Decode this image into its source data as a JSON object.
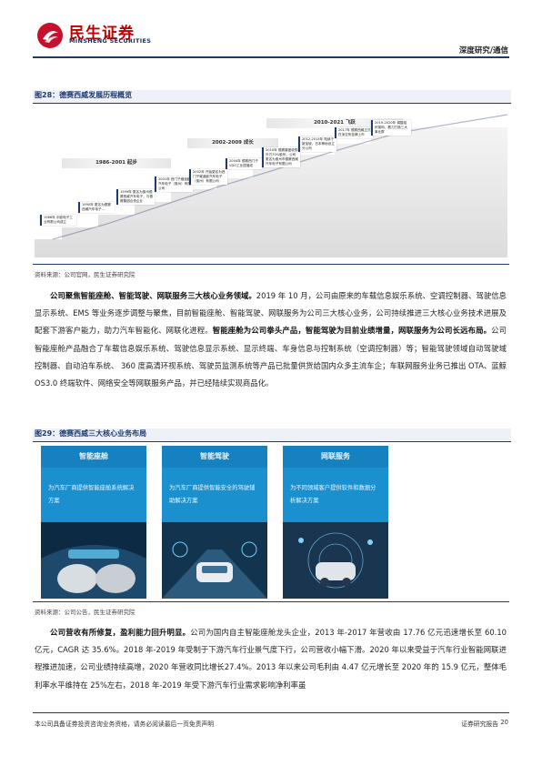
{
  "header": {
    "brand_cn": "民生证券",
    "brand_en": "MINSHENG SECURITIES",
    "section": "深度研究/通信"
  },
  "figure28": {
    "title": "图28：德赛西威发展历程概览",
    "source": "资料来源：公司官网，民生证券研究院",
    "bands": [
      {
        "label": "1986-2001  起步"
      },
      {
        "label": "2002-2009  成长"
      },
      {
        "label": "2010-2021  飞跃"
      }
    ],
    "milestones": [
      {
        "text": "1986年 中欧电子工业有限公司成立"
      },
      {
        "text": "1990年 更名为德赛西威汽车电子…"
      },
      {
        "text": "1999年 更名为惠州德赛西威汽车电子，与德赛集团合资企业"
      },
      {
        "text": "2001年 西门子威迪欧汽车电子（惠州）有限公司"
      },
      {
        "text": "2002年 开始更名为西门子威迪欧汽车电子（惠州）有限公司"
      },
      {
        "text": "2004年 德赛西门子VDO工业园落成"
      },
      {
        "text": "2010年 德赛集团收购外方70%股份，公司更名为惠州市德赛西威汽车电子有限公司"
      },
      {
        "text": "2012-2013年 陆续于新加坡、日本等地设立分公司"
      },
      {
        "text": "2017年 德赛西威正式在深交所挂牌上市"
      },
      {
        "text": "2019-2020年 调整组织架构，着力打造三大事业群"
      }
    ]
  },
  "body1": {
    "p1_bold": "公司聚焦智能座舱、智能驾驶、网联服务三大核心业务领域。",
    "p1_a": "2019 年 10 月，公司由原来的车载信息娱乐系统、空调控制器、驾驶信息显示系统、EMS 等业务逐步调整与聚焦，目前智能座舱、智能驾驶、网联服务为公司三大核心业务，公司持续推进三大核心业务技术进展及配套下游客户能力，助力汽车智能化、网联化进程。",
    "p1_bold2": "智能座舱为公司拳头产品，智能驾驶为目前业绩增量，网联服务为公司长远布局。",
    "p1_b": "公司智能座舱产品融合了车载信息娱乐系统、驾驶信息显示系统、显示终端、车身信息与控制系统（空调控制器）等；智能驾驶领域自动驾驶域控制器、自动泊车系统、 360 度高清环视系统、驾驶员监测系统等产品已批量供货给国内众多主流车企；车联网服务业务已推出 OTA、蓝鲸 OS3.0 终端软件、网络安全等网联服务产品，并已经陆续实现商品化。"
  },
  "figure29": {
    "title": "图29：德赛西威三大核心业务布局",
    "source": "资料来源：公司公告，民生证券研究院",
    "panels": [
      {
        "head": "智能座舱",
        "desc": "为汽车厂商提供智能座舱系统解决方案"
      },
      {
        "head": "智能驾驶",
        "desc": "为汽车厂商提供智能安全的驾驶辅助解决方案"
      },
      {
        "head": "网联服务",
        "desc": "为不同领域客户提供软件和数据分析解决方案"
      }
    ]
  },
  "body2": {
    "p_bold": "公司营收有所修复，盈利能力回升明显。",
    "p_text": "公司为国内自主智能座舱龙头企业，2013 年-2017 年营收由 17.76 亿元迅速增长至 60.10 亿元，CAGR 达 35.6%。2018 年-2019 年受制于下游汽车行业景气度下行，公司营收小幅下滑。2020 年以来受益于汽车行业智能网联进程推进加速，公司业绩持续高增，2020 年营收同比增长27.4%。2013 年以来公司毛利由 4.47 亿元增长至 2020 年的 15.9 亿元，整体毛利率水平维持在 25%左右，2018 年-2019 年受下游汽车行业需求影响净利率虽"
  },
  "footer": {
    "disclaimer": "本公司具备证券投资咨询业务资格，请务必阅读最后一页免责声明",
    "report_type": "证券研究报告",
    "page": "20"
  }
}
